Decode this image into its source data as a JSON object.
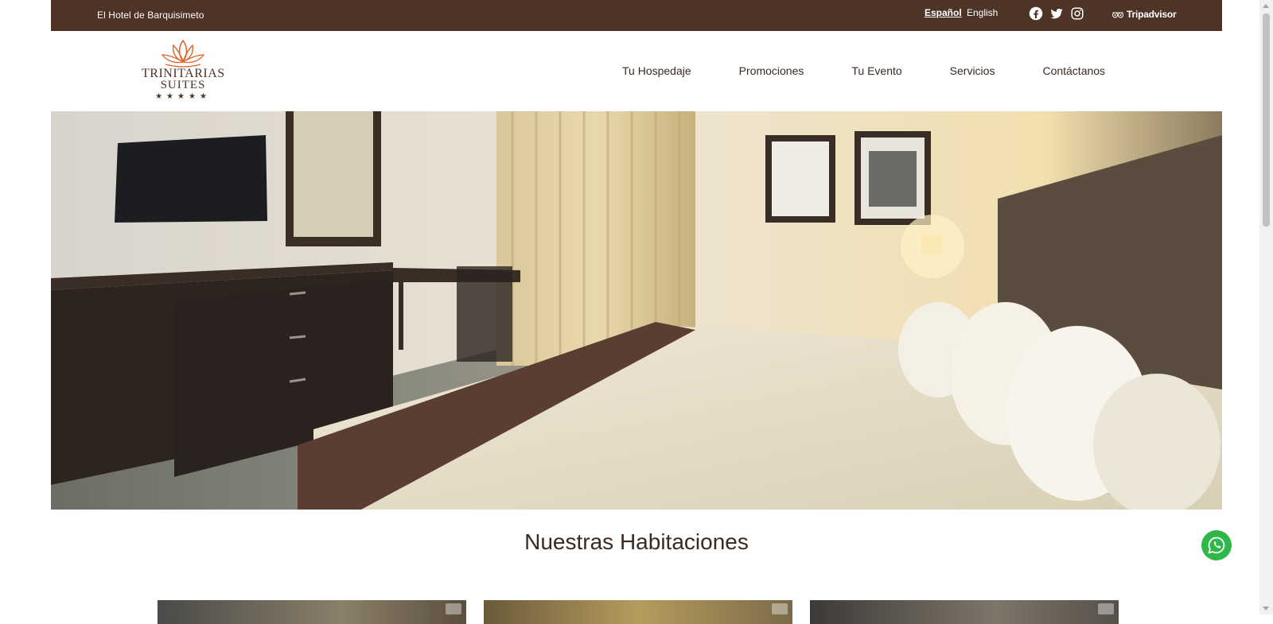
{
  "topbar": {
    "tagline": "El Hotel de Barquisimeto",
    "languages": [
      {
        "label": "Español",
        "active": true
      },
      {
        "label": "English",
        "active": false
      }
    ],
    "social": [
      "facebook-icon",
      "twitter-icon",
      "instagram-icon"
    ],
    "tripadvisor_label": "Tripadvisor"
  },
  "logo": {
    "line1": "Trinitarias",
    "line2": "Suites",
    "stars": "★★★★★"
  },
  "nav": {
    "items": [
      "Tu Hospedaje",
      "Promociones",
      "Tu Evento",
      "Servicios",
      "Contáctanos"
    ]
  },
  "main": {
    "section_title": "Nuestras Habitaciones"
  },
  "colors": {
    "brand_brown": "#4e3327",
    "logo_orange": "#e0652b",
    "whatsapp_green": "#2fb84a"
  }
}
